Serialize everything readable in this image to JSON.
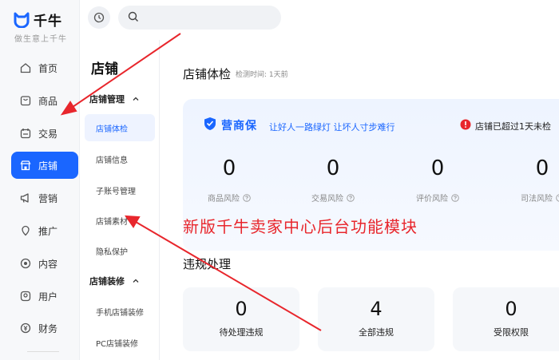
{
  "brand": {
    "name": "千牛",
    "tagline": "做生意上千牛"
  },
  "leftnav": {
    "items": [
      {
        "label": "首页",
        "icon": "home-icon"
      },
      {
        "label": "商品",
        "icon": "goods-icon"
      },
      {
        "label": "交易",
        "icon": "trade-icon"
      },
      {
        "label": "店铺",
        "icon": "store-icon",
        "active": true
      },
      {
        "label": "营销",
        "icon": "megaphone-icon"
      },
      {
        "label": "推广",
        "icon": "promote-icon"
      },
      {
        "label": "内容",
        "icon": "content-icon"
      },
      {
        "label": "用户",
        "icon": "user-icon"
      },
      {
        "label": "财务",
        "icon": "finance-icon"
      }
    ]
  },
  "search": {
    "placeholder": ""
  },
  "subnav": {
    "title": "店铺",
    "groups": [
      {
        "label": "店铺管理",
        "items": [
          "店铺体检",
          "店铺信息",
          "子账号管理",
          "店铺素材",
          "隐私保护"
        ]
      },
      {
        "label": "店铺装修",
        "items": [
          "手机店铺装修",
          "PC店铺装修"
        ]
      }
    ],
    "active_item": "店铺体检"
  },
  "main": {
    "title": "店铺体检",
    "meta": "检测时间: 1天前",
    "health": {
      "brand": "营商保",
      "slogan": "让好人一路绿灯 让坏人寸步难行",
      "warning": "店铺已超过1天未检",
      "risks": [
        {
          "value": "0",
          "label": "商品风险"
        },
        {
          "value": "0",
          "label": "交易风险"
        },
        {
          "value": "0",
          "label": "评价风险"
        },
        {
          "value": "0",
          "label": "司法风险"
        }
      ]
    },
    "violations": {
      "title": "违规处理",
      "cards": [
        {
          "value": "0",
          "label": "待处理违规"
        },
        {
          "value": "4",
          "label": "全部违规"
        },
        {
          "value": "0",
          "label": "受限权限"
        }
      ]
    }
  },
  "annotation": {
    "text": "新版千牛卖家中心后台功能模块",
    "color": "#e8262c"
  },
  "colors": {
    "accent": "#1a66ff",
    "annotation": "#e8262c",
    "warning": "#e8262c"
  }
}
